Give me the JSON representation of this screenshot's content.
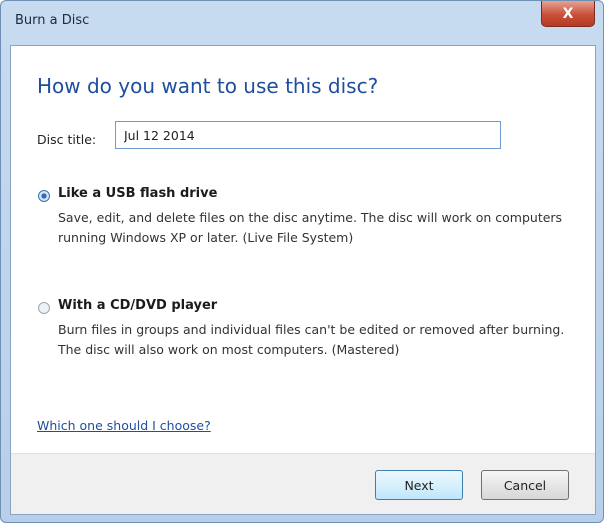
{
  "window": {
    "title": "Burn a Disc",
    "close_label": "X"
  },
  "dialog": {
    "heading": "How do you want to use this disc?",
    "disc_title_label": "Disc title:",
    "disc_title_value": "Jul 12 2014",
    "options": [
      {
        "title": "Like a USB flash drive",
        "description": "Save, edit, and delete files on the disc anytime. The disc will work on computers running Windows XP or later. (Live File System)",
        "selected": true
      },
      {
        "title": "With a CD/DVD player",
        "description": "Burn files in groups and individual files can't be edited or removed after burning. The disc will also work on most computers. (Mastered)",
        "selected": false
      }
    ],
    "help_link": "Which one should I choose?"
  },
  "footer": {
    "next_label": "Next",
    "cancel_label": "Cancel"
  }
}
